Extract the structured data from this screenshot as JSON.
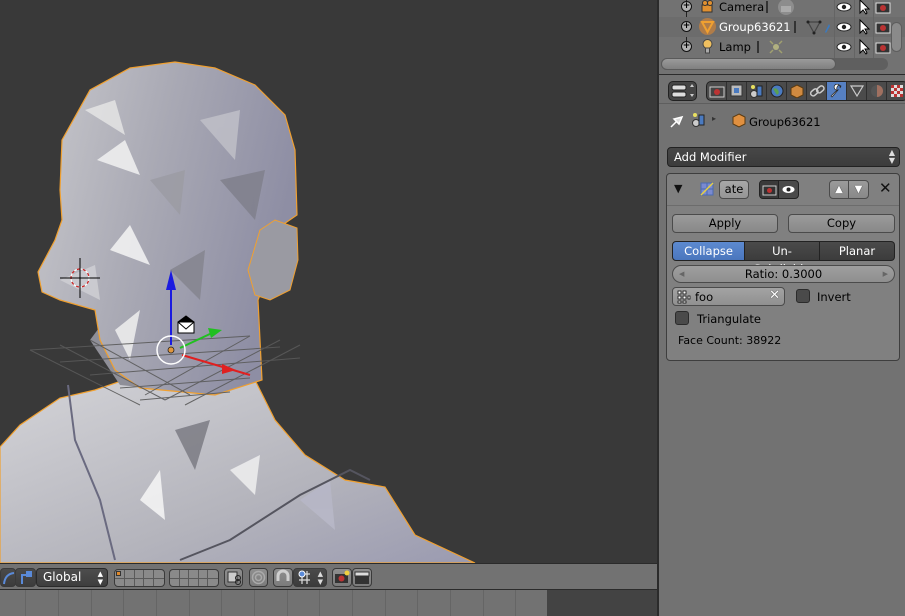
{
  "viewport": {
    "object_name": "Group63621",
    "colors": {
      "background": "#393939",
      "selection_outline": "#f0a030",
      "x_axis": "#e02020",
      "y_axis": "#20c020",
      "z_axis": "#1a1ae0"
    }
  },
  "viewport_header": {
    "transform_orientation": "Global",
    "icons": [
      "rotate-manipulator-icon",
      "scale-manipulator-icon",
      "layers-grid-1",
      "layers-grid-2",
      "lock-camera-icon",
      "proportional-edit-icon",
      "snap-magnet-icon",
      "snap-element-increment-icon",
      "render-opengl-icon",
      "render-animation-icon"
    ]
  },
  "outliner": {
    "rows": [
      {
        "name": "Camera",
        "type": "camera",
        "data_icon": "camera-data-icon"
      },
      {
        "name": "Group63621",
        "type": "mesh",
        "data_icon": "mesh-data-icon",
        "selected": true
      },
      {
        "name": "Lamp",
        "type": "lamp",
        "data_icon": "lamp-data-icon"
      }
    ],
    "toggles": [
      "visibility-eye-icon",
      "selectable-cursor-icon",
      "renderable-camera-icon"
    ]
  },
  "properties": {
    "tabs": [
      {
        "name": "render",
        "icon": "render-camera-icon"
      },
      {
        "name": "render-layers",
        "icon": "render-layers-icon"
      },
      {
        "name": "scene",
        "icon": "scene-icon"
      },
      {
        "name": "world",
        "icon": "world-icon"
      },
      {
        "name": "object",
        "icon": "object-cube-icon"
      },
      {
        "name": "constraints",
        "icon": "chain-link-icon"
      },
      {
        "name": "modifiers",
        "icon": "wrench-icon",
        "active": true
      },
      {
        "name": "data",
        "icon": "mesh-triangle-icon"
      },
      {
        "name": "material",
        "icon": "material-sphere-icon"
      },
      {
        "name": "texture",
        "icon": "texture-checker-icon"
      }
    ],
    "breadcrumb": {
      "object": "Group63621"
    },
    "add_modifier": "Add Modifier",
    "modifier": {
      "name": "ate",
      "apply": "Apply",
      "copy": "Copy",
      "modes": [
        {
          "label": "Collapse",
          "active": true
        },
        {
          "label": "Un-Subdivide",
          "active": false
        },
        {
          "label": "Planar",
          "active": false
        }
      ],
      "ratio_label": "Ratio: 0.3000",
      "ratio_value": 0.3,
      "vertex_group": "foo",
      "invert_label": "Invert",
      "invert_checked": false,
      "triangulate_label": "Triangulate",
      "triangulate_checked": false,
      "face_count": "Face Count: 38922"
    },
    "accent": "#5680c2"
  }
}
